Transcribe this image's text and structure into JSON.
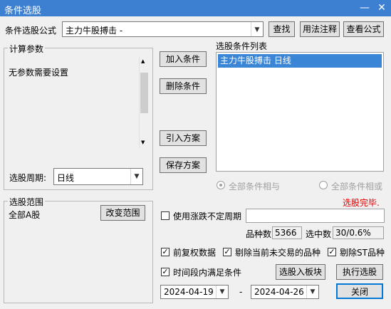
{
  "window": {
    "title": "条件选股",
    "minimize_icon": "—",
    "close_icon": "✕"
  },
  "formula": {
    "label": "条件选股公式",
    "value": "主力牛股搏击 -",
    "find_button": "查找",
    "usage_button": "用法注释",
    "view_button": "查看公式"
  },
  "params": {
    "group_title": "计算参数",
    "text": "无参数需要设置"
  },
  "period": {
    "label": "选股周期:",
    "value": "日线"
  },
  "actions": {
    "add": "加入条件",
    "delete": "删除条件",
    "import": "引入方案",
    "save": "保存方案"
  },
  "conditions": {
    "label": "选股条件列表",
    "items": [
      "主力牛股搏击  日线"
    ],
    "radio_and": "全部条件相与",
    "radio_or": "全部条件相或"
  },
  "status": {
    "text": "选股完毕.",
    "color": "#e00000"
  },
  "scope": {
    "group_title": "选股范围",
    "value": "全部A股",
    "change_button": "改变范围"
  },
  "irregular": {
    "label": "使用涨跌不定周期",
    "checked": false
  },
  "counts": {
    "total_label": "品种数",
    "total": "5366",
    "selected_label": "选中数",
    "selected": "30/0.6%"
  },
  "options": {
    "adjust": {
      "label": "前复权数据",
      "checked": true
    },
    "exclude_untraded": {
      "label": "剔除当前未交易的品种",
      "checked": true
    },
    "exclude_st": {
      "label": "剔除ST品种",
      "checked": true
    },
    "time_range": {
      "label": "时间段内满足条件",
      "checked": true
    }
  },
  "buttons": {
    "to_block": "选股入板块",
    "execute": "执行选股",
    "close": "关闭"
  },
  "dates": {
    "start": "2024-04-19",
    "separator": "-",
    "end": "2024-04-26"
  }
}
